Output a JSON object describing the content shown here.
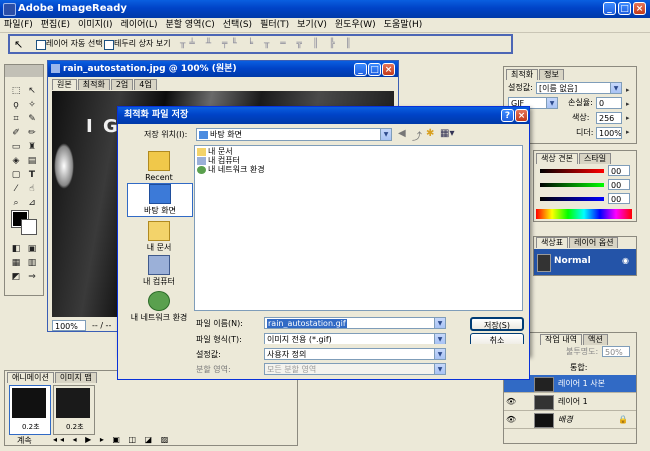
{
  "app": {
    "title": "Adobe ImageReady",
    "menu": [
      "파일(F)",
      "편집(E)",
      "이미지(I)",
      "레이어(L)",
      "분할 영역(C)",
      "선택(S)",
      "필터(T)",
      "보기(V)",
      "윈도우(W)",
      "도움말(H)"
    ]
  },
  "options_bar": {
    "auto_select_layer": "레이어 자동 선택",
    "show_bounding_box": "테두리 상자 보기"
  },
  "document": {
    "title": "rain_autostation.jpg @ 100% (원본)",
    "tabs": [
      "원본",
      "최적화",
      "2업",
      "4업"
    ],
    "zoom": "100%",
    "status": "-- / --"
  },
  "dialog": {
    "title": "최적화 파일 저장",
    "save_in_label": "저장 위치(I):",
    "save_in_value": "바탕 화면",
    "places": [
      "Recent",
      "바탕 화면",
      "내 문서",
      "내 컴퓨터",
      "내 네트워크 환경"
    ],
    "files": [
      "내 문서",
      "내 컴퓨터",
      "내 네트워크 환경"
    ],
    "filename_label": "파일 이름(N):",
    "filename_value": "rain_autostation.gif",
    "format_label": "파일 형식(T):",
    "format_value": "이미지 전용 (*.gif)",
    "settings_label": "설정값:",
    "settings_value": "사용자 정의",
    "slices_label": "분할 영역:",
    "slices_value": "모든 분할 영역",
    "save_button": "저장(S)",
    "cancel_button": "취소"
  },
  "optimize_panel": {
    "tabs": [
      "최적화",
      "정보"
    ],
    "preset_label": "설정값:",
    "preset_value": "[이름 없음]",
    "format_value": "GIF",
    "lossy_label": "손실율:",
    "lossy_value": "0",
    "colors_label": "색상:",
    "colors_value": "256",
    "dither_label": "디더:",
    "dither_value": "100%"
  },
  "color_panel": {
    "tabs": [
      "색상 견본",
      "스타일"
    ],
    "r": "00",
    "g": "00",
    "b": "00"
  },
  "effect_panel": {
    "tabs": [
      "색상표",
      "레이어 옵션"
    ],
    "mode_value": "Normal"
  },
  "layers_panel": {
    "tabs": [
      "작업 내역",
      "액션"
    ],
    "opacity_label": "불투명도:",
    "opacity_value": "50%",
    "unify_label": "통합:",
    "layers": [
      "레이어 1 사본",
      "레이어 1",
      "배경"
    ]
  },
  "animation_panel": {
    "tabs": [
      "애니메이션",
      "이미지 맵"
    ],
    "frame_delays": [
      "0.2초",
      "0.2초"
    ],
    "loop_value": "계속"
  },
  "colors": {
    "title_bar": "#0a5fe0",
    "selected_layer": "#316ac5",
    "normal_row": "#2454a8"
  }
}
